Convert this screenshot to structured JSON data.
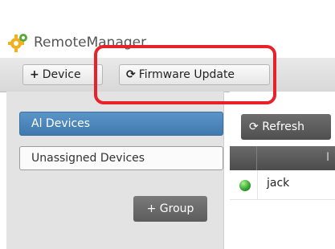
{
  "app": {
    "title": "RemoteManager"
  },
  "toolbar": {
    "add_device_label": "Device",
    "add_device_icon": "plus-icon",
    "firmware_update_label": "Firmware Update",
    "firmware_update_icon": "refresh-icon"
  },
  "sidebar": {
    "items": [
      {
        "label": "Al Devices",
        "active": true
      },
      {
        "label": "Unassigned Devices",
        "active": false
      }
    ],
    "group_button_label": "Group",
    "group_button_icon": "plus-icon"
  },
  "main": {
    "refresh_label": "Refresh",
    "refresh_icon": "refresh-icon",
    "table": {
      "columns": [
        "",
        "I"
      ],
      "rows": [
        {
          "status": "online",
          "name": "jack"
        }
      ]
    }
  },
  "colors": {
    "annotation": "#e8222a",
    "active_nav": "#4a86bd",
    "status_online": "#2fa12d"
  }
}
